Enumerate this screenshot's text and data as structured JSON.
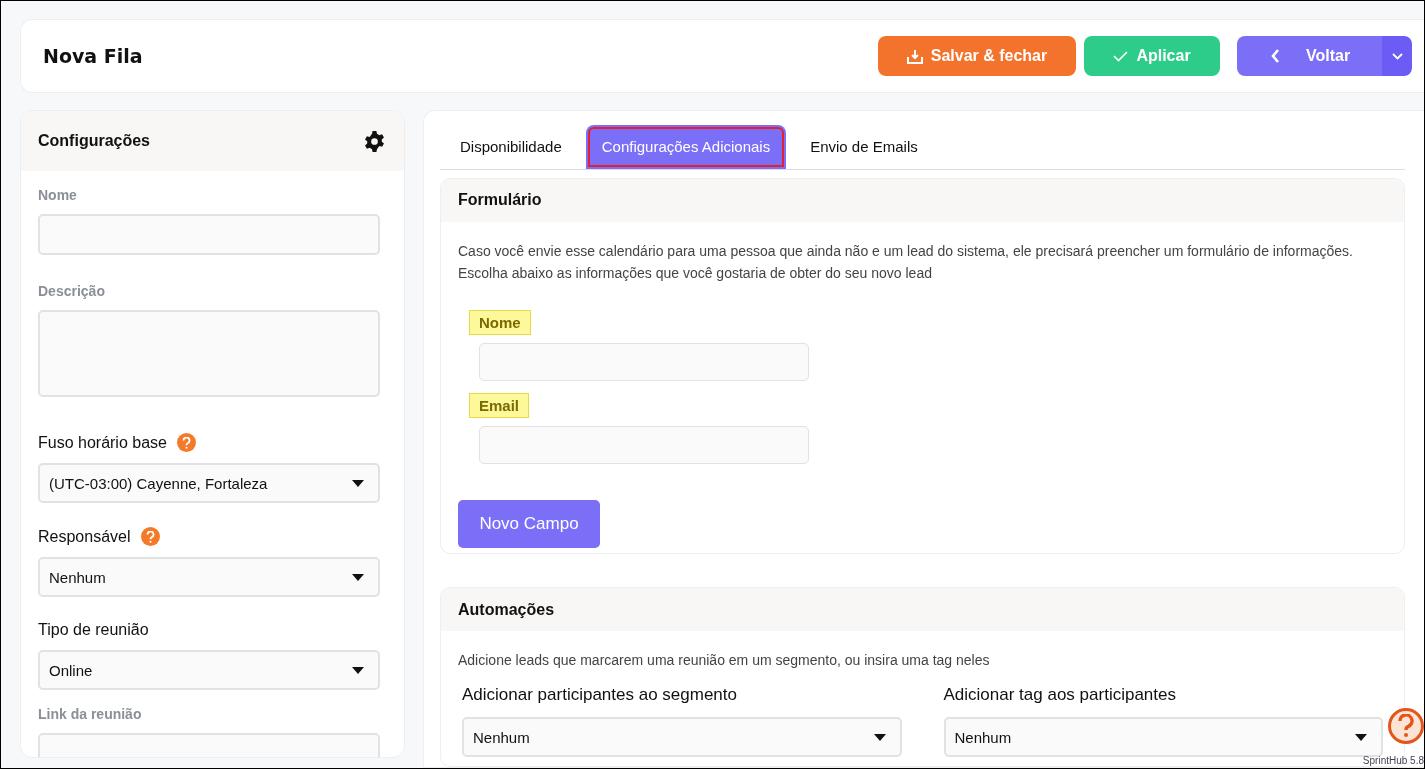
{
  "header": {
    "title": "Nova Fila",
    "buttons": [
      {
        "kind": "save",
        "label": "Salvar & fechar"
      },
      {
        "kind": "apply",
        "label": "Aplicar"
      },
      {
        "kind": "back",
        "label": "Voltar"
      }
    ]
  },
  "sidebar": {
    "title": "Configurações",
    "fields": [
      {
        "kind": "input",
        "label": "Nome",
        "muted": true
      },
      {
        "kind": "textarea",
        "label": "Descrição",
        "muted": true
      },
      {
        "kind": "select",
        "label": "Fuso horário base",
        "help": true,
        "value": "(UTC-03:00) Cayenne, Fortaleza"
      },
      {
        "kind": "select",
        "label": "Responsável",
        "help": true,
        "value": "Nenhum"
      },
      {
        "kind": "select",
        "label": "Tipo de reunião",
        "help": false,
        "value": "Online"
      },
      {
        "kind": "input",
        "label": "Link da reunião",
        "muted": true
      }
    ]
  },
  "tabs": [
    {
      "label": "Disponibilidade",
      "selected": false,
      "outlined": false
    },
    {
      "label": "Configurações Adicionais",
      "selected": true,
      "outlined": true
    },
    {
      "label": "Envio de Emails",
      "selected": false,
      "outlined": false
    }
  ],
  "form_section": {
    "title": "Formulário",
    "description": "Caso você envie esse calendário para uma pessoa que ainda não e um lead do sistema, ele precisará preencher um formulário de informações. Escolha abaixo as informações que você gostaria de obter do seu novo lead",
    "fields": [
      {
        "label": "Nome",
        "highlighted": true
      },
      {
        "label": "Email",
        "highlighted": true
      }
    ],
    "button": "Novo Campo"
  },
  "automations": {
    "title": "Automações",
    "description": "Adicione leads que marcarem uma reunião em um segmento, ou insira uma tag neles",
    "selects": [
      {
        "label": "Adicionar participantes ao segmento",
        "value": "Nenhum"
      },
      {
        "label": "Adicionar tag aos participantes",
        "value": "Nenhum"
      }
    ]
  },
  "version": "SprintHub 5.8"
}
